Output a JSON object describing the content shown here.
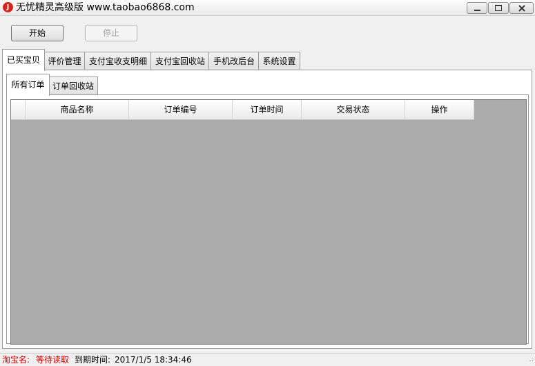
{
  "window": {
    "title": "无忧精灵高级版 www.taobao6868.com",
    "icon": "app-logo-icon"
  },
  "toolbar": {
    "start_label": "开始",
    "stop_label": "停止"
  },
  "tabs": [
    {
      "label": "已买宝贝",
      "active": true
    },
    {
      "label": "评价管理",
      "active": false
    },
    {
      "label": "支付宝收支明细",
      "active": false
    },
    {
      "label": "支付宝回收站",
      "active": false
    },
    {
      "label": "手机改后台",
      "active": false
    },
    {
      "label": "系统设置",
      "active": false
    }
  ],
  "subtabs": [
    {
      "label": "所有订单",
      "active": true
    },
    {
      "label": "订单回收站",
      "active": false
    }
  ],
  "grid": {
    "columns": [
      "商品名称",
      "订单编号",
      "订单时间",
      "交易状态",
      "操作"
    ],
    "rows": []
  },
  "status": {
    "taobao_label": "淘宝名:",
    "taobao_value": "等待读取",
    "expiry_label": "到期时间:",
    "expiry_value": "2017/1/5 18:34:46"
  },
  "colors": {
    "status_red": "#d40000",
    "grid_background": "#ababab"
  }
}
